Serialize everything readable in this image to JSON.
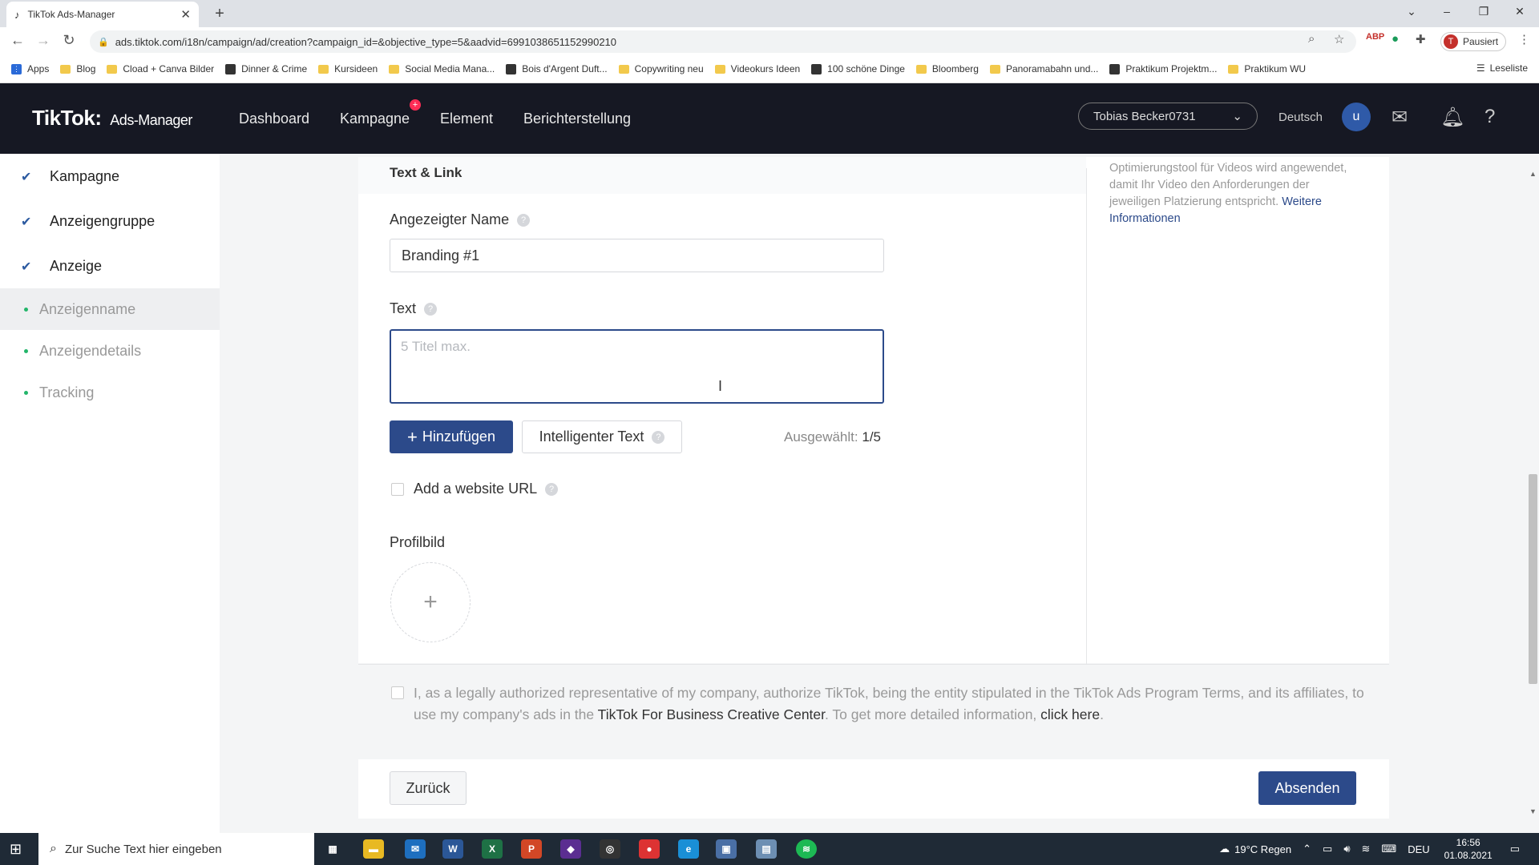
{
  "browser": {
    "tab_title": "TikTok Ads-Manager",
    "url": "ads.tiktok.com/i18n/campaign/ad/creation?campaign_id=&objective_type=5&aadvid=6991038651152990210",
    "profile_initial": "T",
    "profile_label": "Pausiert",
    "bookmarks": [
      {
        "label": "Apps",
        "kind": "grid"
      },
      {
        "label": "Blog",
        "kind": "folder"
      },
      {
        "label": "Cload + Canva Bilder",
        "kind": "folder"
      },
      {
        "label": "Dinner & Crime",
        "kind": "site"
      },
      {
        "label": "Kursideen",
        "kind": "folder"
      },
      {
        "label": "Social Media Mana...",
        "kind": "folder"
      },
      {
        "label": "Bois d'Argent Duft...",
        "kind": "site"
      },
      {
        "label": "Copywriting neu",
        "kind": "folder"
      },
      {
        "label": "Videokurs Ideen",
        "kind": "folder"
      },
      {
        "label": "100 schöne Dinge",
        "kind": "site"
      },
      {
        "label": "Bloomberg",
        "kind": "folder"
      },
      {
        "label": "Panoramabahn und...",
        "kind": "folder"
      },
      {
        "label": "Praktikum Projektm...",
        "kind": "site"
      },
      {
        "label": "Praktikum WU",
        "kind": "folder"
      }
    ],
    "reading_list": "Leseliste"
  },
  "header": {
    "logo": "TikTok",
    "logo_sub": "Ads-Manager",
    "nav": [
      "Dashboard",
      "Kampagne",
      "Element",
      "Berichterstellung"
    ],
    "account": "Tobias Becker0731",
    "language": "Deutsch",
    "user_initial": "u"
  },
  "sidebar": {
    "steps": [
      "Kampagne",
      "Anzeigengruppe",
      "Anzeige"
    ],
    "substeps": [
      "Anzeigenname",
      "Anzeigendetails",
      "Tracking"
    ]
  },
  "form": {
    "section_title": "Text & Link",
    "display_name_label": "Angezeigter Name",
    "display_name_value": "Branding #1",
    "text_label": "Text",
    "text_placeholder": "5 Titel max.",
    "add_button": "Hinzufügen",
    "smart_text_button": "Intelligenter Text",
    "selected_label": "Ausgewählt:",
    "selected_value": "1/5",
    "website_url_label": "Add a website URL",
    "profile_image_label": "Profilbild"
  },
  "tip": {
    "text": "Optimierungstool für Videos wird angewendet, damit Ihr Video den Anforderungen der jeweiligen Platzierung entspricht.",
    "link": "Weitere Informationen"
  },
  "consent": {
    "text1": "I, as a legally authorized representative of my company, authorize TikTok, being the entity stipulated in the TikTok Ads Program Terms, and its affiliates, to use my company's ads in the",
    "link1": "TikTok For Business Creative Center",
    "text2": ". To get more detailed information,",
    "link2": "click here",
    "text3": "."
  },
  "footer": {
    "back": "Zurück",
    "submit": "Absenden"
  },
  "taskbar": {
    "search_placeholder": "Zur Suche Text hier eingeben",
    "weather": "19°C Regen",
    "lang": "DEU",
    "time": "16:56",
    "date": "01.08.2021"
  },
  "colors": {
    "accent": "#2c4a8a",
    "header_bg": "#161823",
    "success": "#23b56a"
  }
}
